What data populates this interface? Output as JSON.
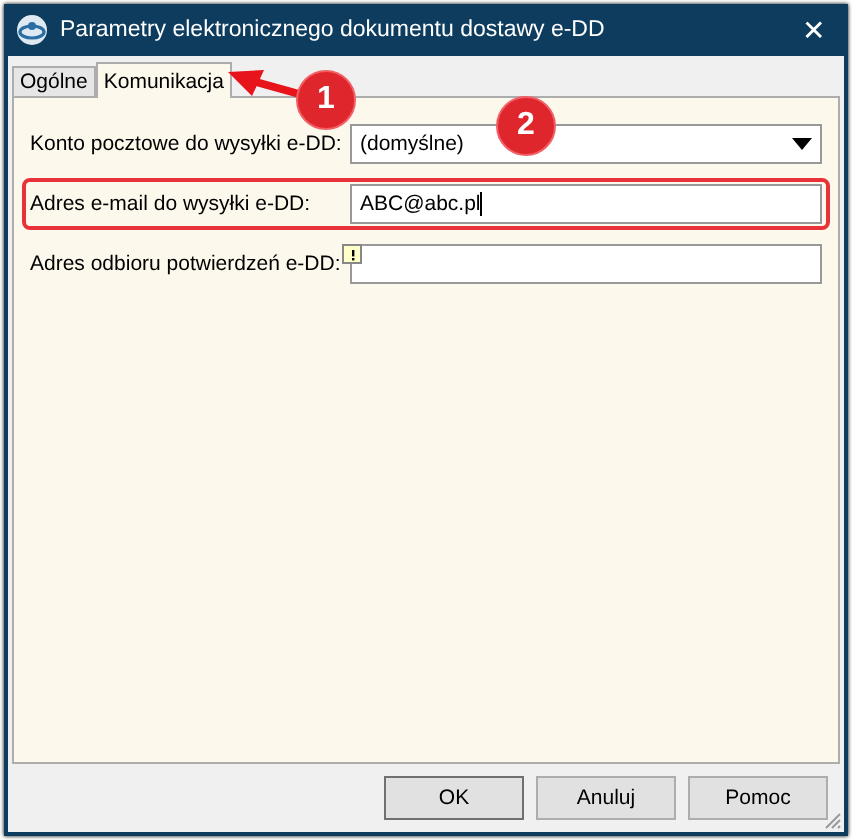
{
  "window": {
    "title": "Parametry elektronicznego dokumentu dostawy e-DD",
    "close": "✕"
  },
  "tabs": [
    {
      "label": "Ogólne",
      "selected": false
    },
    {
      "label": "Komunikacja",
      "selected": true
    }
  ],
  "fields": [
    {
      "kind": "dropdown",
      "label": "Konto pocztowe do wysyłki e-DD:",
      "value": "(domyślne)",
      "highlighted": false,
      "warning": false
    },
    {
      "kind": "text",
      "label": "Adres e-mail do wysyłki e-DD:",
      "value": "ABC@abc.pl",
      "highlighted": true,
      "warning": false
    },
    {
      "kind": "text",
      "label": "Adres odbioru potwierdzeń e-DD:",
      "highlighted": false,
      "warning": true
    }
  ],
  "buttons": [
    "OK",
    "Anuluj",
    "Pomoc"
  ],
  "callouts": [
    "1",
    "2"
  ]
}
